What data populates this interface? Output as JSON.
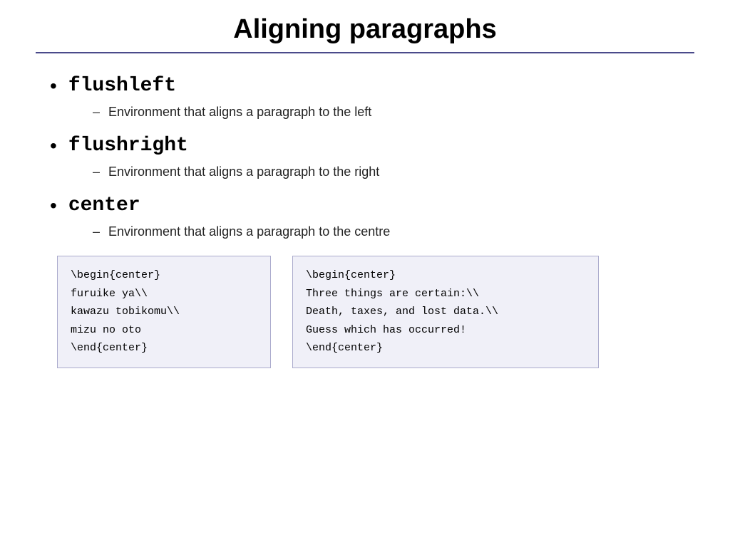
{
  "title": "Aligning paragraphs",
  "bullets": [
    {
      "id": "flushleft",
      "label": "flushleft",
      "sub": "Environment that aligns a paragraph to the left"
    },
    {
      "id": "flushright",
      "label": "flushright",
      "sub": "Environment that aligns a paragraph to the right"
    },
    {
      "id": "center",
      "label": "center",
      "sub": "Environment that aligns a paragraph to the centre"
    }
  ],
  "code_boxes": [
    {
      "id": "code1",
      "content": "\\begin{center}\nfuruike ya\\\\\nkawazu tobikomu\\\\\nmizu no oto\n\\end{center}"
    },
    {
      "id": "code2",
      "content": "\\begin{center}\nThree things are certain:\\\\\nDeath, taxes, and lost data.\\\\\nGuess which has occurred!\n\\end{center}"
    }
  ],
  "dash": "–"
}
